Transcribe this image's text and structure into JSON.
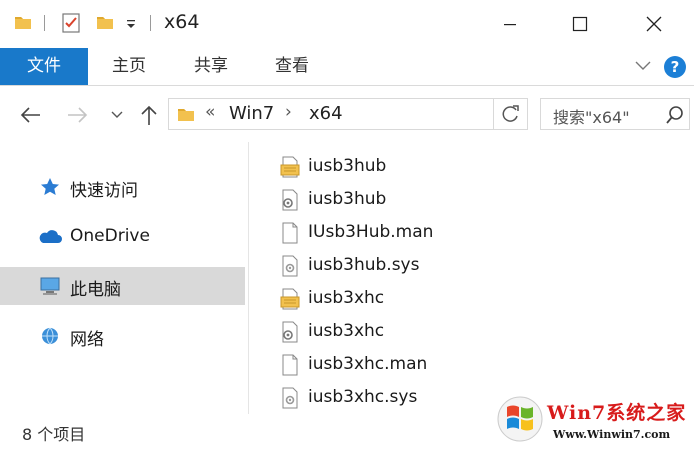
{
  "window": {
    "title": "x64"
  },
  "ribbon": {
    "tabs": [
      {
        "label": "文件",
        "active": true
      },
      {
        "label": "主页"
      },
      {
        "label": "共享"
      },
      {
        "label": "查看"
      }
    ],
    "help_label": "?"
  },
  "address": {
    "overflow": "«",
    "crumbs": [
      "Win7",
      "x64"
    ],
    "separator": "›"
  },
  "search": {
    "placeholder": "搜索\"x64\""
  },
  "sidebar": {
    "items": [
      {
        "label": "快速访问",
        "icon": "star-icon"
      },
      {
        "label": "OneDrive",
        "icon": "cloud-icon"
      },
      {
        "label": "此电脑",
        "icon": "computer-icon",
        "selected": true
      },
      {
        "label": "网络",
        "icon": "network-icon"
      }
    ]
  },
  "files": [
    {
      "name": "iusb3hub",
      "icon": "setup-info-icon"
    },
    {
      "name": "iusb3hub",
      "icon": "gear-file-icon"
    },
    {
      "name": "IUsb3Hub.man",
      "icon": "blank-file-icon"
    },
    {
      "name": "iusb3hub.sys",
      "icon": "system-file-icon"
    },
    {
      "name": "iusb3xhc",
      "icon": "setup-info-icon"
    },
    {
      "name": "iusb3xhc",
      "icon": "gear-file-icon"
    },
    {
      "name": "iusb3xhc.man",
      "icon": "blank-file-icon"
    },
    {
      "name": "iusb3xhc.sys",
      "icon": "system-file-icon"
    }
  ],
  "status": {
    "item_count": "8 个项目"
  },
  "watermark": {
    "title": "Win7系统之家",
    "url": "Www.Winwin7.com"
  },
  "colors": {
    "accent": "#1979ca",
    "selected": "#d9d9d9",
    "folder": "#f2c14e"
  }
}
